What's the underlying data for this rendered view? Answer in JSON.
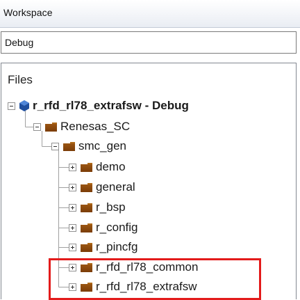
{
  "window": {
    "title": "Workspace"
  },
  "config": {
    "selected": "Debug"
  },
  "tree": {
    "header": "Files",
    "project": {
      "label": "r_rfd_rl78_extrafsw - Debug",
      "icon": "project-icon"
    },
    "items": [
      {
        "label": "Renesas_SC",
        "icon": "folder-icon"
      },
      {
        "label": "smc_gen",
        "icon": "folder-icon"
      },
      {
        "label": "demo",
        "icon": "folder-icon"
      },
      {
        "label": "general",
        "icon": "folder-icon"
      },
      {
        "label": "r_bsp",
        "icon": "folder-icon"
      },
      {
        "label": "r_config",
        "icon": "folder-icon"
      },
      {
        "label": "r_pincfg",
        "icon": "folder-icon"
      },
      {
        "label": "r_rfd_rl78_common",
        "icon": "folder-icon"
      },
      {
        "label": "r_rfd_rl78_extrafsw",
        "icon": "folder-icon"
      }
    ]
  },
  "highlight": {
    "color": "#e31b1b"
  }
}
